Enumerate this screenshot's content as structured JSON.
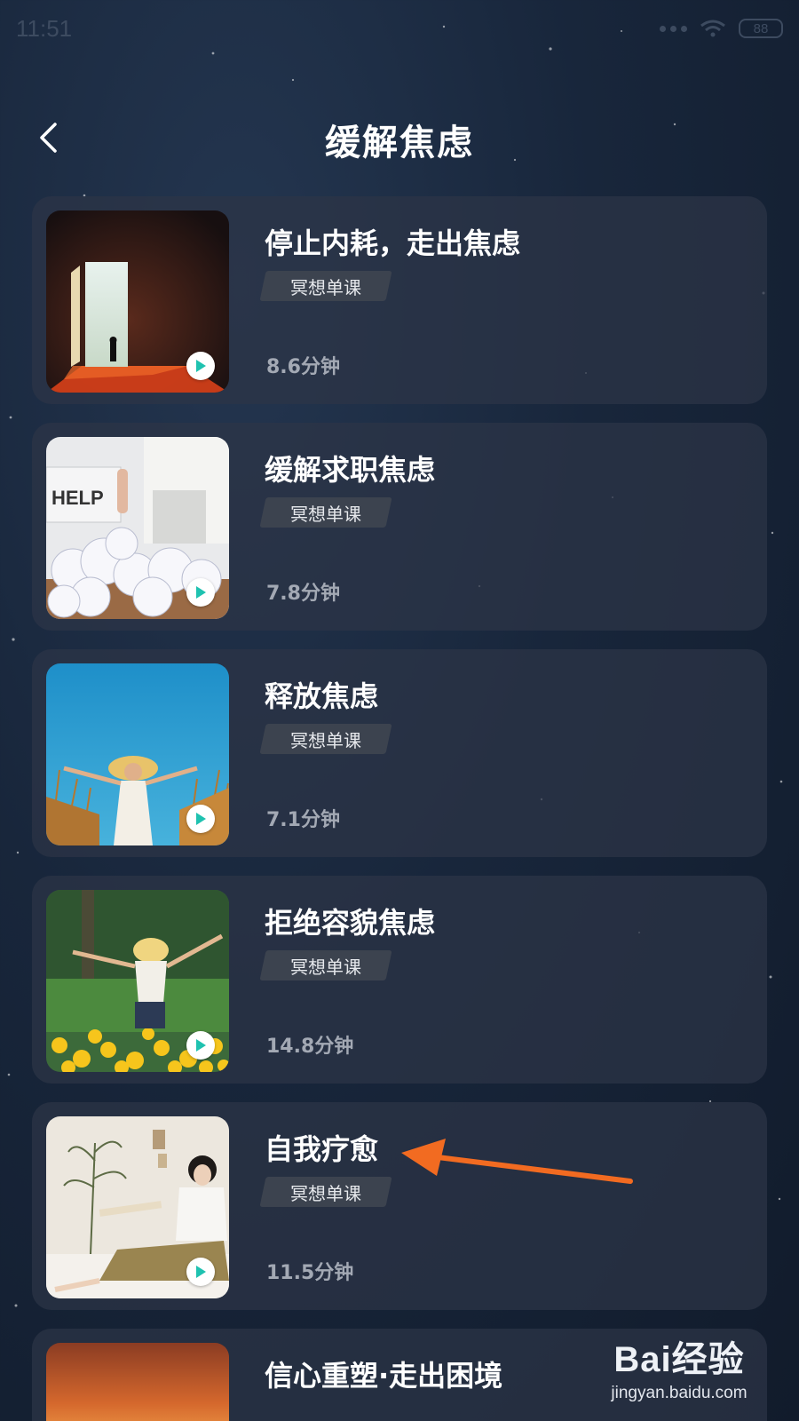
{
  "status_bar": {
    "time": "11:51",
    "battery": "88"
  },
  "header": {
    "title": "缓解焦虑",
    "back_icon": "chevron-left-icon"
  },
  "courses": [
    {
      "title": "停止内耗，走出焦虑",
      "tag": "冥想单课",
      "duration": "8.6分钟",
      "thumbnail": "glowing-door-silhouette"
    },
    {
      "title": "缓解求职焦虑",
      "tag": "冥想单课",
      "duration": "7.8分钟",
      "thumbnail": "help-sign-paper-pile",
      "thumbnail_text": "HELP"
    },
    {
      "title": "释放焦虑",
      "tag": "冥想单课",
      "duration": "7.1分钟",
      "thumbnail": "woman-wheat-field-blue-sky"
    },
    {
      "title": "拒绝容貌焦虑",
      "tag": "冥想单课",
      "duration": "14.8分钟",
      "thumbnail": "woman-flower-field-park"
    },
    {
      "title": "自我疗愈",
      "tag": "冥想单课",
      "duration": "11.5分钟",
      "thumbnail": "woman-sitting-bed-reading"
    },
    {
      "title": "信心重塑·走出困境",
      "tag": "",
      "duration": "",
      "thumbnail": "sunset-orange"
    }
  ],
  "watermark": {
    "logo": "Bai经验",
    "url": "jingyan.baidu.com"
  },
  "colors": {
    "accent_play": "#1fc2b0",
    "annotation_arrow": "#f26b21",
    "card_bg": "#2c3546"
  }
}
